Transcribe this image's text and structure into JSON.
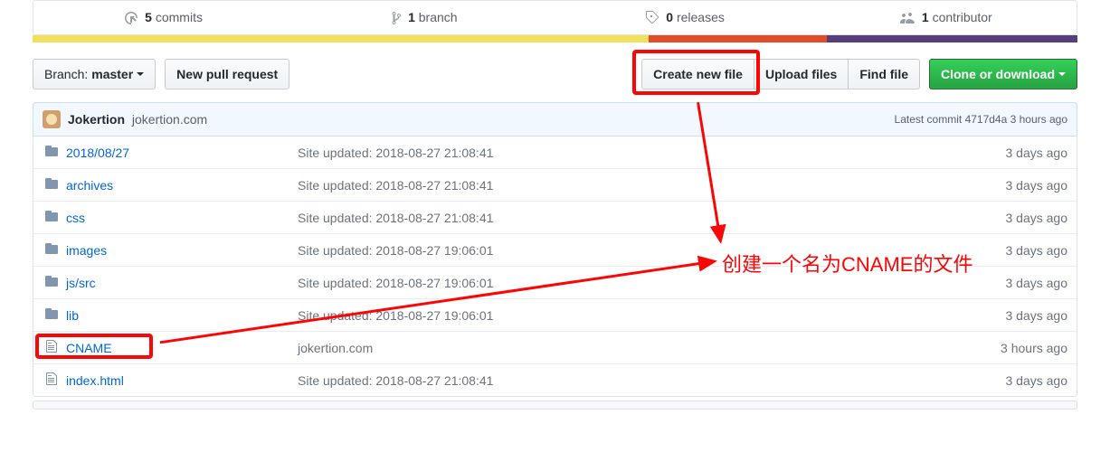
{
  "stats": {
    "commits": {
      "count": "5",
      "label": "commits"
    },
    "branches": {
      "count": "1",
      "label": "branch"
    },
    "releases": {
      "count": "0",
      "label": "releases"
    },
    "contributors": {
      "count": "1",
      "label": "contributor"
    }
  },
  "toolbar": {
    "branch_prefix": "Branch: ",
    "branch_name": "master",
    "new_pr": "New pull request",
    "create_file": "Create new file",
    "upload_files": "Upload files",
    "find_file": "Find file",
    "clone": "Clone or download"
  },
  "commit_bar": {
    "author": "Jokertion",
    "message": "jokertion.com",
    "latest_label": "Latest commit ",
    "sha": "4717d4a",
    "time": " 3 hours ago"
  },
  "files": [
    {
      "type": "dir",
      "name": "2018/08/27",
      "msg": "Site updated: 2018-08-27 21:08:41",
      "age": "3 days ago"
    },
    {
      "type": "dir",
      "name": "archives",
      "msg": "Site updated: 2018-08-27 21:08:41",
      "age": "3 days ago"
    },
    {
      "type": "dir",
      "name": "css",
      "msg": "Site updated: 2018-08-27 21:08:41",
      "age": "3 days ago"
    },
    {
      "type": "dir",
      "name": "images",
      "msg": "Site updated: 2018-08-27 19:06:01",
      "age": "3 days ago"
    },
    {
      "type": "dir",
      "name": "js/src",
      "msg": "Site updated: 2018-08-27 19:06:01",
      "age": "3 days ago"
    },
    {
      "type": "dir",
      "name": "lib",
      "msg": "Site updated: 2018-08-27 19:06:01",
      "age": "3 days ago"
    },
    {
      "type": "file",
      "name": "CNAME",
      "msg": "jokertion.com",
      "age": "3 hours ago"
    },
    {
      "type": "file",
      "name": "index.html",
      "msg": "Site updated: 2018-08-27 21:08:41",
      "age": "3 days ago"
    }
  ],
  "annotation": {
    "text": "创建一个名为CNAME的文件"
  }
}
